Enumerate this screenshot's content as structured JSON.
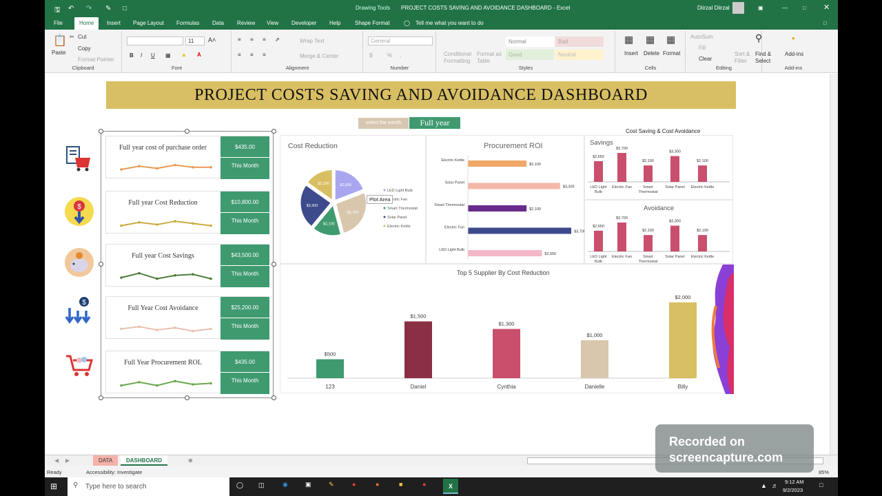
{
  "window": {
    "title": "PROJECT COSTS SAVING AND AVOIDANCE DASHBOARD  -  Excel",
    "context_tab": "Drawing Tools",
    "user": "Diirzal Diirzal"
  },
  "menu": {
    "items": [
      "File",
      "Home",
      "Insert",
      "Page Layout",
      "Formulas",
      "Data",
      "Review",
      "View",
      "Developer",
      "Help",
      "Shape Format"
    ],
    "tell_me": "Tell me what you want to do"
  },
  "ribbon": {
    "clipboard": {
      "paste": "Paste",
      "cut": "Cut",
      "copy": "Copy",
      "format_painter": "Format Painter",
      "label": "Clipboard"
    },
    "font": {
      "size": "11",
      "label": "Font"
    },
    "alignment": {
      "wrap": "Wrap Text",
      "merge": "Merge & Center",
      "label": "Alignment"
    },
    "number": {
      "format": "General",
      "label": "Number"
    },
    "styles": {
      "conditional": "Conditional Formatting",
      "format_table": "Format as Table",
      "normal": "Normal",
      "bad": "Bad",
      "good": "Good",
      "neutral": "Neutral",
      "label": "Styles"
    },
    "cells": {
      "insert": "Insert",
      "delete": "Delete",
      "format": "Format",
      "label": "Cells"
    },
    "editing": {
      "autosum": "AutoSum",
      "fill": "Fill",
      "clear": "Clear",
      "sort": "Sort & Filter",
      "find": "Find & Select",
      "label": "Editing"
    },
    "addins": {
      "addins": "Add-ins",
      "label": "Add-ins"
    }
  },
  "dashboard": {
    "title": "PROJECT COSTS SAVING AND AVOIDANCE DASHBOARD",
    "select_label": "select the month",
    "select_value": "Full year",
    "kpis": [
      {
        "label": "Full year cost of purchase order",
        "value": "$435.00",
        "period": "This Month",
        "color": "#e79a55"
      },
      {
        "label": "Full year Cost Reduction",
        "value": "$10,800.00",
        "period": "This Month",
        "color": "#c9ab3f"
      },
      {
        "label": "Full year Cost Savings",
        "value": "$43,500.00",
        "period": "This Month",
        "color": "#4e7d3a"
      },
      {
        "label": "Full Year Cost Avoidance",
        "value": "$25,200.00",
        "period": "This Month",
        "color": "#e8c0b0"
      },
      {
        "label": "Full Year Procurement ROL",
        "value": "$435.00",
        "period": "This Month",
        "color": "#6aa84f"
      }
    ],
    "icons": [
      "purchase-order-icon",
      "cost-reduction-icon",
      "piggy-bank-icon",
      "cost-avoidance-icon",
      "shopping-cart-icon"
    ],
    "tooltip": "Plot Area"
  },
  "chart_data": [
    {
      "type": "pie",
      "title": "Cost Reduction",
      "categories": [
        "LED Light Bulb",
        "Electric Fan",
        "Smart Thermostat",
        "Solar Panel",
        "Electric Kettle"
      ],
      "values": [
        2650,
        3700,
        2100,
        3300,
        2100
      ],
      "labels": [
        "$2,650",
        "$3,700",
        "$2,100",
        "$3,300",
        "$2,100"
      ],
      "colors": [
        "#a9a6f0",
        "#d8c7ac",
        "#3f9a70",
        "#3d4a8c",
        "#d9bf63"
      ]
    },
    {
      "type": "bar",
      "orientation": "horizontal",
      "title": "Procurement ROI",
      "categories": [
        "Electric Kettle",
        "Solar Panel",
        "Smart Thermostat",
        "Electric Fan",
        "LED Light Bulb"
      ],
      "values": [
        2100,
        3300,
        2100,
        3700,
        2650
      ],
      "labels": [
        "$2,100",
        "$3,300",
        "$2,100",
        "$3,700",
        "$2,650"
      ],
      "colors": [
        "#f0a868",
        "#f5b8a8",
        "#6a2b8c",
        "#3d4a8c",
        "#f5b8c8"
      ]
    },
    {
      "type": "bar",
      "title": "Savings",
      "suptitle": "Cost Saving & Cost Avoidance",
      "categories": [
        "LED Light Bulb",
        "Electric Fan",
        "Smart Thermostat",
        "Solar Panel",
        "Electric Kettle"
      ],
      "values": [
        2650,
        3700,
        2100,
        3300,
        2100
      ],
      "labels": [
        "$2,650",
        "$3,700",
        "$2,100",
        "$3,300",
        "$2,100"
      ],
      "color": "#c94f6d"
    },
    {
      "type": "bar",
      "title": "Avoidance",
      "categories": [
        "LED Light Bulb",
        "Electric Fan",
        "Smart Thermostat",
        "Solar Panel",
        "Electric Kettle"
      ],
      "values": [
        2650,
        3700,
        2100,
        3300,
        2100
      ],
      "labels": [
        "$2,650",
        "$3,700",
        "$2,100",
        "$3,300",
        "$2,100"
      ],
      "color": "#c94f6d"
    },
    {
      "type": "bar",
      "title": "Top 5 Supplier By Cost Reduction",
      "categories": [
        "123",
        "Daniel",
        "Cynthia",
        "Danielle",
        "Billy"
      ],
      "values": [
        500,
        1500,
        1300,
        1000,
        2000
      ],
      "labels": [
        "$500",
        "$1,500",
        "$1,300",
        "$1,000",
        "$2,000"
      ],
      "colors": [
        "#3f9a70",
        "#8b2f45",
        "#c94f6d",
        "#d8c7ac",
        "#d9bf63"
      ]
    }
  ],
  "sheets": {
    "tabs": [
      "DATA",
      "DASHBOARD"
    ],
    "active": "DASHBOARD"
  },
  "status": {
    "ready": "Ready",
    "accessibility": "Accessibility: Investigate",
    "zoom": "85%"
  },
  "taskbar": {
    "search": "Type here to search",
    "time": "9:12 AM",
    "date": "9/2/2023"
  },
  "watermark": {
    "line1": "Recorded on",
    "line2": "screencapture.com"
  }
}
